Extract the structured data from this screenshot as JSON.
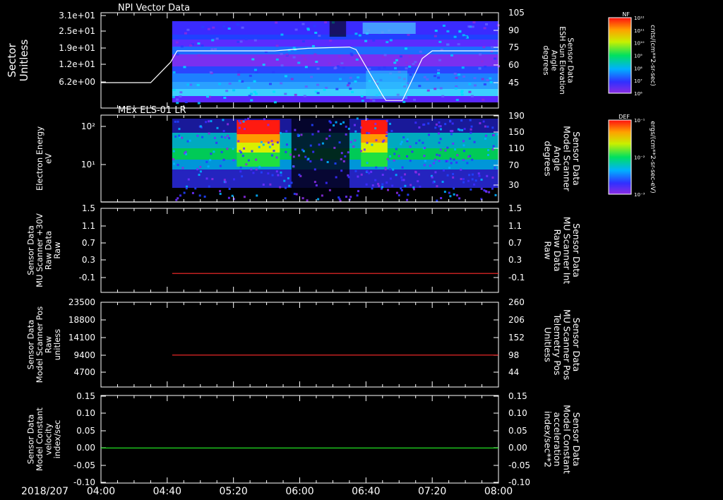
{
  "colors": {
    "background": "#000000",
    "axis": "#ffffff",
    "text": "#ffffff",
    "red_trace": "#ff2a2a",
    "green_trace": "#22dd22",
    "elevation_trace": "#ffffff"
  },
  "footer": {
    "date_label": "2018/207",
    "time_ticks": [
      "04:00",
      "04:40",
      "05:20",
      "06:00",
      "06:40",
      "07:20",
      "08:00"
    ]
  },
  "chart_data": [
    {
      "type": "heatmap",
      "title": "NPI Vector Data",
      "ylabel": [
        "Sector",
        "Unitless"
      ],
      "yticks": [
        "3.1e+01",
        "2.5e+01",
        "1.9e+01",
        "1.2e+01",
        "6.2e+00"
      ],
      "ylim": [
        0,
        32
      ],
      "right_ylabel": [
        "Sensor Data",
        "ESH Sun Elevation",
        "Angle",
        "degrees"
      ],
      "right_yticks": [
        "105",
        "90",
        "75",
        "60",
        "45"
      ],
      "right_ylim": [
        30,
        105
      ],
      "colorbar": {
        "title": "NF",
        "units": "cnts/(cm**2-sr-sec)",
        "ticks": [
          "10¹²",
          "10¹¹",
          "10¹⁰",
          "10⁹",
          "10⁸",
          "10⁷",
          "10⁶"
        ]
      },
      "overlay_line": {
        "name": "ESH Sun Elevation Angle",
        "x": [
          "04:00",
          "04:30",
          "04:42",
          "04:46",
          "05:00",
          "05:45",
          "06:05",
          "06:30",
          "06:34",
          "06:50",
          "06:52",
          "07:00",
          "07:02",
          "07:14",
          "07:20",
          "08:00"
        ],
        "y": [
          50,
          50,
          66,
          75,
          75,
          75,
          77,
          78,
          76,
          40,
          36,
          36,
          36,
          69,
          75,
          75
        ]
      },
      "data_start": "04:43"
    },
    {
      "type": "heatmap",
      "title": "MEx ELS-01 LR",
      "ylabel": [
        "Electron Energy",
        "eV"
      ],
      "yticks": [
        "10²",
        "10¹"
      ],
      "ylim": [
        1,
        200
      ],
      "yscale": "log",
      "right_ylabel": [
        "Sensor Data",
        "Model Scanner",
        "Angle",
        "degrees"
      ],
      "right_yticks": [
        "190",
        "150",
        "110",
        "70",
        "30"
      ],
      "right_ylim": [
        10,
        190
      ],
      "colorbar": {
        "title": "DEF",
        "units": "ergs/(cm**2-sr-sec-eV)",
        "ticks": [
          "10⁻¹",
          "10⁻²",
          "10⁻³"
        ]
      },
      "overlay_line": {
        "name": "Model Scanner Angle",
        "x": [
          "04:00",
          "08:00"
        ],
        "y": [
          10,
          10
        ]
      },
      "data_start": "04:43"
    },
    {
      "type": "line",
      "ylabel": [
        "Sensor Data",
        "MU Scanner +30V",
        "Raw Data",
        "Raw"
      ],
      "yticks": [
        "1.5",
        "1.1",
        "0.7",
        "0.3",
        "-0.1"
      ],
      "ylim": [
        -0.5,
        1.5
      ],
      "right_ylabel": [
        "Sensor Data",
        "MU Scanner Int",
        "Raw Data",
        "Raw"
      ],
      "right_yticks": [
        "1.5",
        "1.1",
        "0.7",
        "0.3",
        "-0.1"
      ],
      "right_ylim": [
        -0.5,
        1.5
      ],
      "series": [
        {
          "x": [
            "04:43",
            "08:00"
          ],
          "y": [
            -0.05,
            -0.05
          ],
          "color": "#ff2a2a"
        }
      ]
    },
    {
      "type": "line",
      "ylabel": [
        "Sensor Data",
        "Model Scanner Pos",
        "Raw",
        "unitless"
      ],
      "yticks": [
        "23500",
        "18800",
        "14100",
        "9400",
        "4700"
      ],
      "ylim": [
        0,
        23500
      ],
      "right_ylabel": [
        "Sensor Data",
        "MU Scanner Pos",
        "Telemetry Pos",
        "Unitless"
      ],
      "right_yticks": [
        "260",
        "206",
        "152",
        "98",
        "44"
      ],
      "right_ylim": [
        0,
        260
      ],
      "series": [
        {
          "x": [
            "04:43",
            "08:00"
          ],
          "y": [
            8850,
            8850
          ],
          "color": "#ff2a2a"
        }
      ]
    },
    {
      "type": "line",
      "ylabel": [
        "Sensor Data",
        "Model Constant",
        "velocity",
        "index/sec"
      ],
      "yticks": [
        "0.15",
        "0.10",
        "0.05",
        "0.00",
        "-0.05",
        "-0.10"
      ],
      "ylim": [
        -0.1,
        0.15
      ],
      "right_ylabel": [
        "Sensor Data",
        "Model Constant",
        "acceleration",
        "index/sec**2"
      ],
      "right_yticks": [
        "0.15",
        "0.10",
        "0.05",
        "0.00",
        "-0.05",
        "-0.10"
      ],
      "right_ylim": [
        -0.1,
        0.15
      ],
      "series": [
        {
          "x": [
            "04:00",
            "08:00"
          ],
          "y": [
            0.0,
            0.0
          ],
          "color": "#22dd22"
        }
      ]
    }
  ]
}
